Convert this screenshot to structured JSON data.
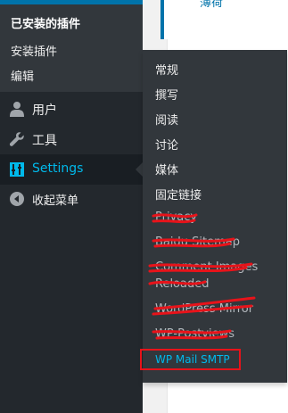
{
  "content": {
    "top_link": "薄荷"
  },
  "sidebar": {
    "submenu_current": "已安装的插件",
    "submenu": [
      "安装插件",
      "编辑"
    ],
    "items": [
      {
        "label": "用户",
        "icon": "user-icon"
      },
      {
        "label": "工具",
        "icon": "wrench-icon"
      },
      {
        "label": "Settings",
        "icon": "settings-sliders-icon",
        "active": true
      },
      {
        "label": "收起菜单",
        "icon": "collapse-arrow-icon"
      }
    ]
  },
  "flyout": {
    "items": [
      "常规",
      "撰写",
      "阅读",
      "讨论",
      "媒体",
      "固定链接",
      "Privacy",
      "Baidu Sitemap",
      "Comment Images",
      "Reloaded",
      "WordPress Mirror",
      "WP-Postviews"
    ],
    "highlighted": "WP Mail SMTP"
  },
  "colors": {
    "accent": "#00b9eb",
    "highlight_border": "#e8131a",
    "sidebar_bg": "#23282d",
    "submenu_bg": "#32373c"
  }
}
